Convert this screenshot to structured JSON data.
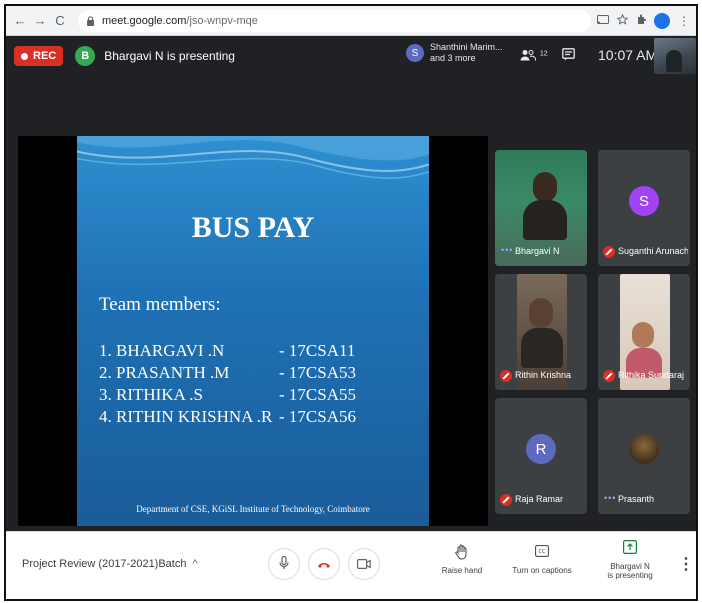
{
  "browser": {
    "url_host": "meet.google.com",
    "url_path": "/jso-wnpv-mqe",
    "nav_back": "←",
    "nav_forward": "→",
    "nav_reload": "C",
    "lock": "🔒",
    "icons": [
      "cast-icon",
      "star-icon",
      "extension-icon"
    ],
    "profile_initial": "",
    "menu": "⋮"
  },
  "meet_top": {
    "rec_label": "REC",
    "presenter_initial": "B",
    "presenting_text": "Bhargavi N is presenting",
    "chip_initial": "S",
    "chip_line1": "Shanthini Marim...",
    "chip_line2": "and 3 more",
    "participants_count": "12",
    "time": "10:07 AM"
  },
  "slide": {
    "title": "BUS PAY",
    "subtitle": "Team members:",
    "members": [
      {
        "name": "1. BHARGAVI .N",
        "code": "- 17CSA11"
      },
      {
        "name": "2. PRASANTH .M",
        "code": "- 17CSA53"
      },
      {
        "name": "3. RITHIKA .S",
        "code": "- 17CSA55"
      },
      {
        "name": "4. RITHIN  KRISHNA .R",
        "code": "- 17CSA56"
      }
    ],
    "footer": "Department of CSE, KGiSL Institute of Technology, Coimbatore"
  },
  "tiles": [
    {
      "name": "Bhargavi N",
      "status": "talking"
    },
    {
      "name": "Suganthi Arunach...",
      "status": "muted",
      "initial": "S",
      "color": "#9c27b0"
    },
    {
      "name": "Rithin Krishna",
      "status": "muted"
    },
    {
      "name": "Rithika Sundaraj",
      "status": "muted"
    },
    {
      "name": "Raja Ramar",
      "status": "muted",
      "initial": "R",
      "color": "#5c6bc0"
    },
    {
      "name": "Prasanth",
      "status": "talking"
    }
  ],
  "bottom": {
    "meeting_title": "Project Review (2017-2021)Batch",
    "caret": "^",
    "raise_hand": "Raise hand",
    "captions": "Turn on captions",
    "presenting_line1": "Bhargavi N",
    "presenting_line2": "is presenting",
    "more": "⋮"
  },
  "colors": {
    "rec_red": "#d93025",
    "presenter_green": "#34a853",
    "meet_dark": "#202124",
    "tile_gray": "#3c4043"
  }
}
